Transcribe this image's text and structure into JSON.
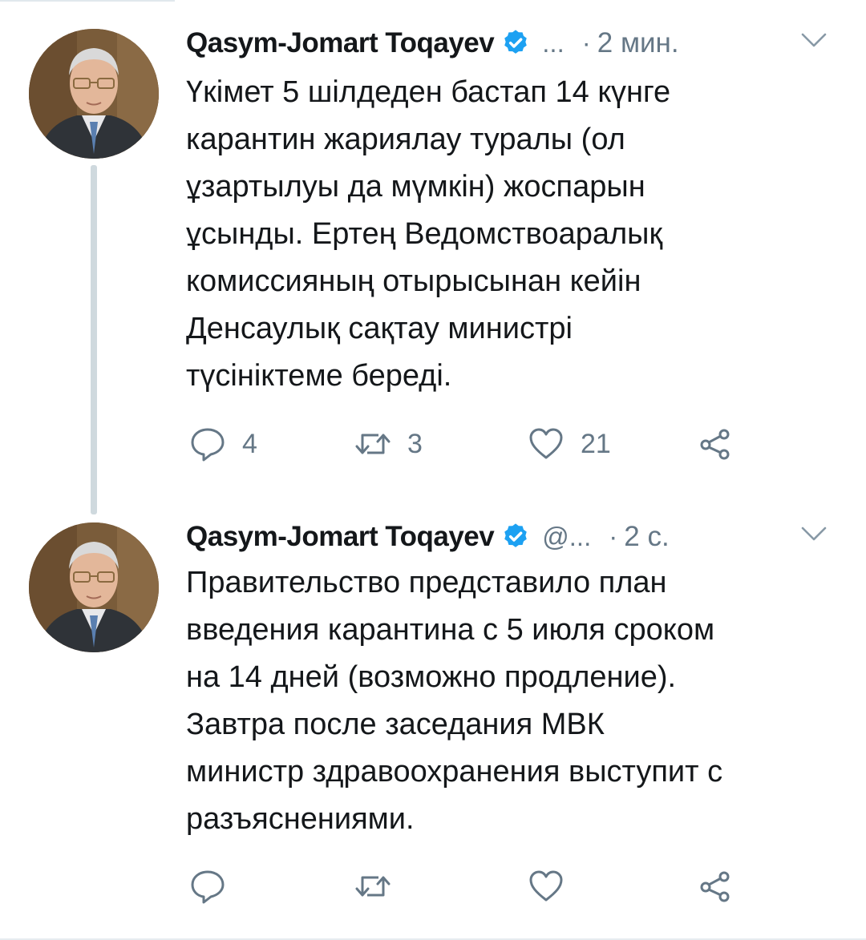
{
  "colors": {
    "text": "#14171a",
    "secondary": "#657786",
    "verified": "#1da1f2",
    "divider": "#e6ecf0"
  },
  "tweets": [
    {
      "author": "Qasym-Jomart Toqayev",
      "handle": "...",
      "separator": "·",
      "time": "2 мин.",
      "text": "Үкімет 5 шілдеден бастап 14 күнге\nкарантин жариялау туралы (ол\nұзартылуы да мүмкін) жоспарын\nұсынды. Ертең Ведомствоаралық\nкомиссияның отырысынан кейін\nДенсаулық сақтау министрі\nтүсініктеме береді.",
      "replies": "4",
      "retweets": "3",
      "likes": "21"
    },
    {
      "author": "Qasym-Jomart Toqayev",
      "handle": "@...",
      "separator": "·",
      "time": "2 с.",
      "text": "Правительство представило план\nвведения карантина с 5 июля сроком\nна 14 дней (возможно продление).\nЗавтра после заседания МВК\nминистр здравоохранения выступит с\nразъяснениями.",
      "replies": "",
      "retweets": "",
      "likes": ""
    }
  ],
  "icons": {
    "reply": "reply-icon",
    "retweet": "retweet-icon",
    "like": "heart-icon",
    "share": "share-icon",
    "verified": "verified-badge-icon",
    "more": "chevron-down-icon"
  }
}
